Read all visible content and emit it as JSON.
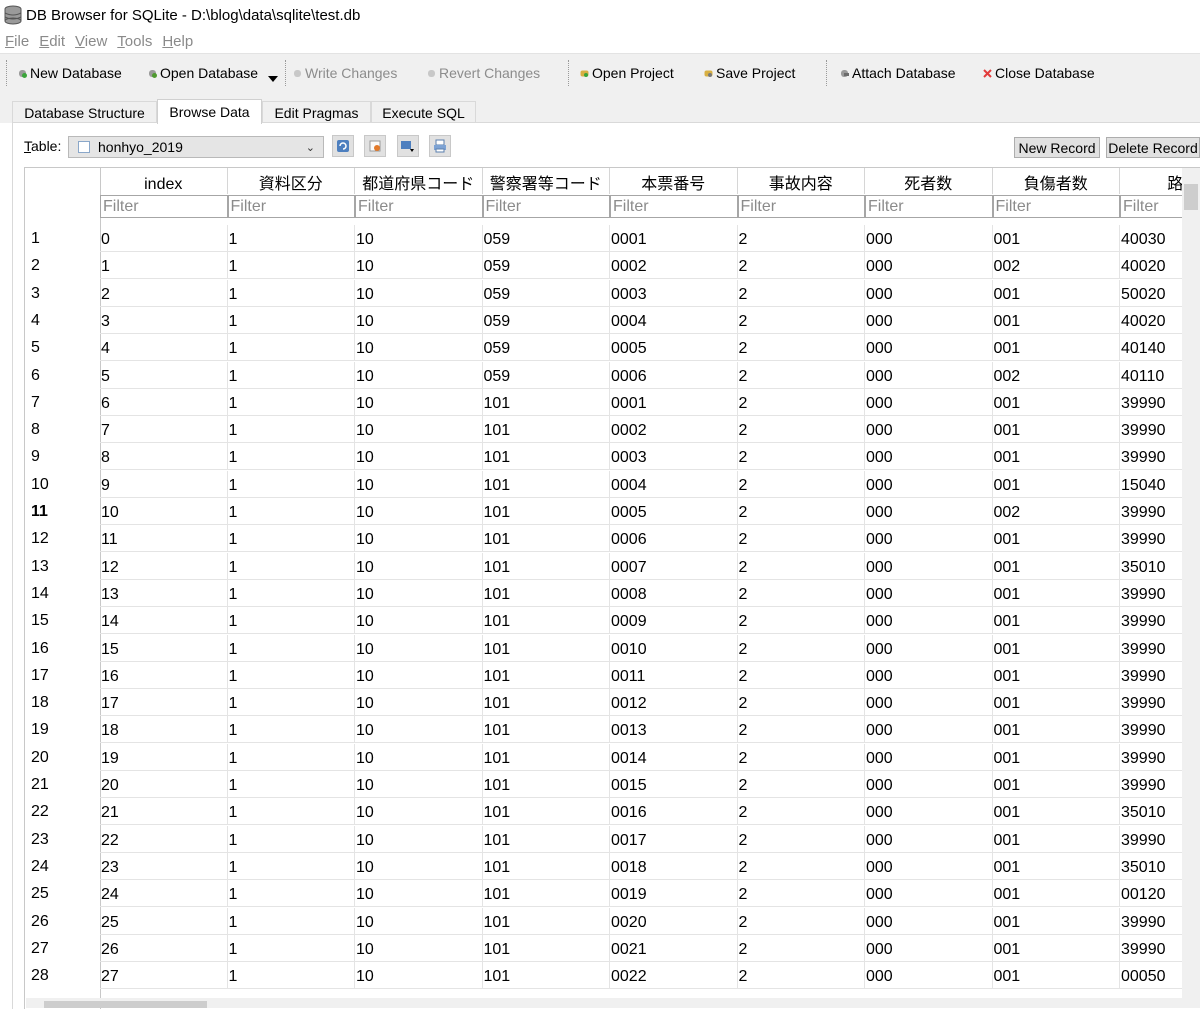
{
  "window": {
    "title": "DB Browser for SQLite - D:\\blog\\data\\sqlite\\test.db"
  },
  "menu": [
    {
      "key": "F",
      "rest": "ile"
    },
    {
      "key": "E",
      "rest": "dit"
    },
    {
      "key": "V",
      "rest": "iew"
    },
    {
      "key": "T",
      "rest": "ools"
    },
    {
      "key": "H",
      "rest": "elp"
    }
  ],
  "toolbar": {
    "new_database": "New Database",
    "open_database": "Open Database",
    "write_changes": "Write Changes",
    "revert_changes": "Revert Changes",
    "open_project": "Open Project",
    "save_project": "Save Project",
    "attach_database": "Attach Database",
    "close_database": "Close Database"
  },
  "tabs": [
    "Database Structure",
    "Browse Data",
    "Edit Pragmas",
    "Execute SQL"
  ],
  "browse": {
    "table_label_key": "T",
    "table_label_rest": "able:",
    "selected_table": "honhyo_2019",
    "new_record": "New Record",
    "delete_record": "Delete Record",
    "filter_placeholder": "Filter"
  },
  "columns": [
    "index",
    "資料区分",
    "都道府県コード",
    "警察署等コード",
    "本票番号",
    "事故内容",
    "死者数",
    "負傷者数",
    "路線"
  ],
  "rows": [
    [
      "1",
      "0",
      "1",
      "10",
      "059",
      "0001",
      "2",
      "000",
      "001",
      "40030"
    ],
    [
      "2",
      "1",
      "1",
      "10",
      "059",
      "0002",
      "2",
      "000",
      "002",
      "40020"
    ],
    [
      "3",
      "2",
      "1",
      "10",
      "059",
      "0003",
      "2",
      "000",
      "001",
      "50020"
    ],
    [
      "4",
      "3",
      "1",
      "10",
      "059",
      "0004",
      "2",
      "000",
      "001",
      "40020"
    ],
    [
      "5",
      "4",
      "1",
      "10",
      "059",
      "0005",
      "2",
      "000",
      "001",
      "40140"
    ],
    [
      "6",
      "5",
      "1",
      "10",
      "059",
      "0006",
      "2",
      "000",
      "002",
      "40110"
    ],
    [
      "7",
      "6",
      "1",
      "10",
      "101",
      "0001",
      "2",
      "000",
      "001",
      "39990"
    ],
    [
      "8",
      "7",
      "1",
      "10",
      "101",
      "0002",
      "2",
      "000",
      "001",
      "39990"
    ],
    [
      "9",
      "8",
      "1",
      "10",
      "101",
      "0003",
      "2",
      "000",
      "001",
      "39990"
    ],
    [
      "10",
      "9",
      "1",
      "10",
      "101",
      "0004",
      "2",
      "000",
      "001",
      "15040"
    ],
    [
      "11",
      "10",
      "1",
      "10",
      "101",
      "0005",
      "2",
      "000",
      "002",
      "39990"
    ],
    [
      "12",
      "11",
      "1",
      "10",
      "101",
      "0006",
      "2",
      "000",
      "001",
      "39990"
    ],
    [
      "13",
      "12",
      "1",
      "10",
      "101",
      "0007",
      "2",
      "000",
      "001",
      "35010"
    ],
    [
      "14",
      "13",
      "1",
      "10",
      "101",
      "0008",
      "2",
      "000",
      "001",
      "39990"
    ],
    [
      "15",
      "14",
      "1",
      "10",
      "101",
      "0009",
      "2",
      "000",
      "001",
      "39990"
    ],
    [
      "16",
      "15",
      "1",
      "10",
      "101",
      "0010",
      "2",
      "000",
      "001",
      "39990"
    ],
    [
      "17",
      "16",
      "1",
      "10",
      "101",
      "0011",
      "2",
      "000",
      "001",
      "39990"
    ],
    [
      "18",
      "17",
      "1",
      "10",
      "101",
      "0012",
      "2",
      "000",
      "001",
      "39990"
    ],
    [
      "19",
      "18",
      "1",
      "10",
      "101",
      "0013",
      "2",
      "000",
      "001",
      "39990"
    ],
    [
      "20",
      "19",
      "1",
      "10",
      "101",
      "0014",
      "2",
      "000",
      "001",
      "39990"
    ],
    [
      "21",
      "20",
      "1",
      "10",
      "101",
      "0015",
      "2",
      "000",
      "001",
      "39990"
    ],
    [
      "22",
      "21",
      "1",
      "10",
      "101",
      "0016",
      "2",
      "000",
      "001",
      "35010"
    ],
    [
      "23",
      "22",
      "1",
      "10",
      "101",
      "0017",
      "2",
      "000",
      "001",
      "39990"
    ],
    [
      "24",
      "23",
      "1",
      "10",
      "101",
      "0018",
      "2",
      "000",
      "001",
      "35010"
    ],
    [
      "25",
      "24",
      "1",
      "10",
      "101",
      "0019",
      "2",
      "000",
      "001",
      "00120"
    ],
    [
      "26",
      "25",
      "1",
      "10",
      "101",
      "0020",
      "2",
      "000",
      "001",
      "39990"
    ],
    [
      "27",
      "26",
      "1",
      "10",
      "101",
      "0021",
      "2",
      "000",
      "001",
      "39990"
    ],
    [
      "28",
      "27",
      "1",
      "10",
      "101",
      "0022",
      "2",
      "000",
      "001",
      "00050"
    ]
  ],
  "current_row": "11",
  "colors": {
    "close_x": "#e23b3b",
    "tab_bg": "#f0f0f0",
    "grid_line": "#e4e4e4"
  }
}
